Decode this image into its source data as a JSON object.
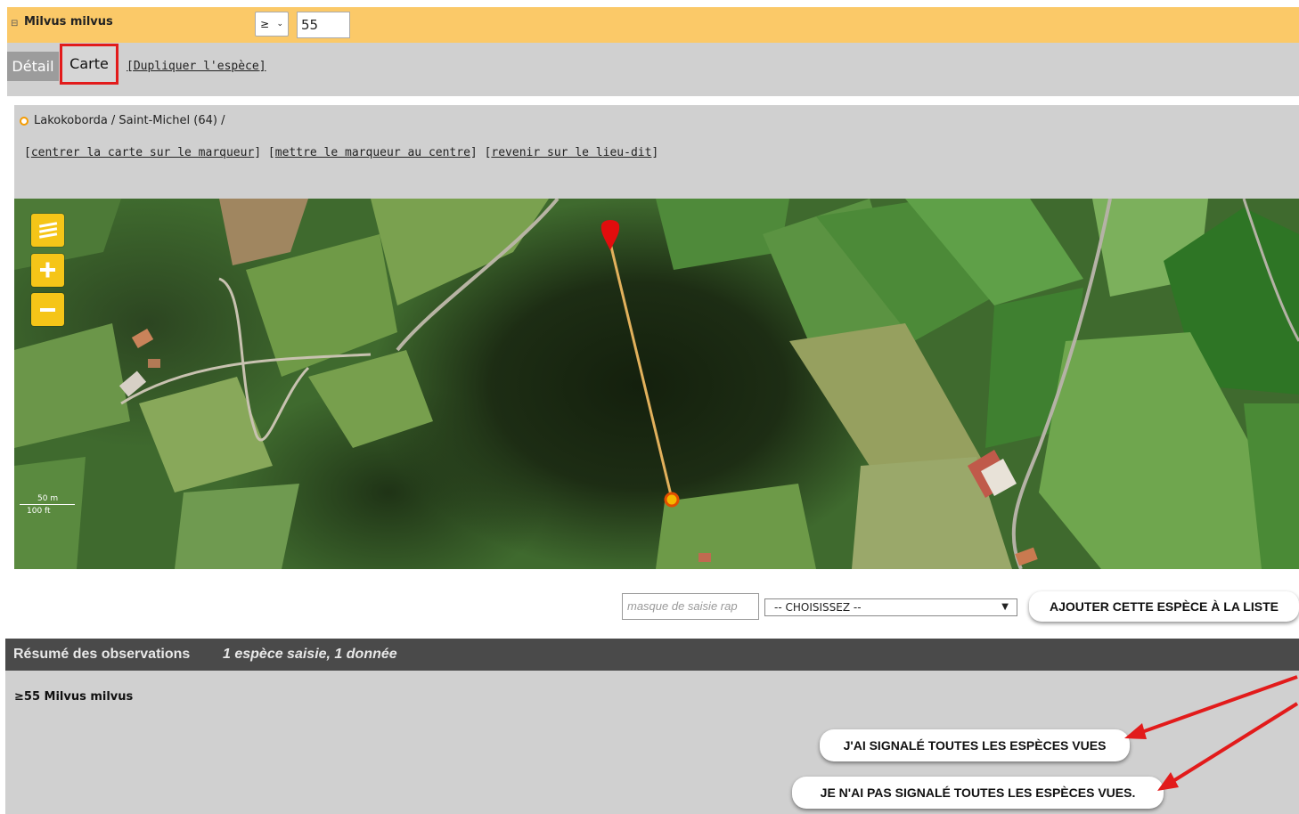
{
  "species": {
    "toggle_icon": "⊟",
    "name": "Milvus milvus",
    "operator": "≥",
    "count": "55"
  },
  "tabs": {
    "detail": "Détail",
    "carte": "Carte",
    "duplicate": "Dupliquer l'espèce"
  },
  "location": {
    "path": "Lakokoborda / Saint-Michel (64) /",
    "links": [
      "centrer la carte sur le marqueur",
      "mettre le marqueur au centre",
      "revenir sur le lieu-dit"
    ]
  },
  "map": {
    "controls": [
      "layers-icon",
      "zoom-in-icon",
      "zoom-out-icon"
    ],
    "scale": {
      "metric": "50 m",
      "imperial": "100 ft"
    }
  },
  "entry_row": {
    "mask_placeholder": "masque de saisie rap",
    "select_value": "-- CHOISISSEZ --",
    "add_button": "AJOUTER CETTE ESPÈCE À LA LISTE"
  },
  "summary": {
    "title": "Résumé des observations",
    "subtitle": "1 espèce saisie, 1 donnée",
    "entry": "≥55 Milvus milvus",
    "btn_all": "J'AI SIGNALÉ TOUTES LES ESPÈCES VUES",
    "btn_not_all": "JE N'AI PAS SIGNALÉ TOUTES LES ESPÈCES VUES."
  },
  "colors": {
    "species_bar": "#fbc968",
    "panel": "#d0d0d0",
    "summary_header": "#4a4a4a",
    "highlight": "#e21b1b",
    "map_control": "#f5c518"
  }
}
